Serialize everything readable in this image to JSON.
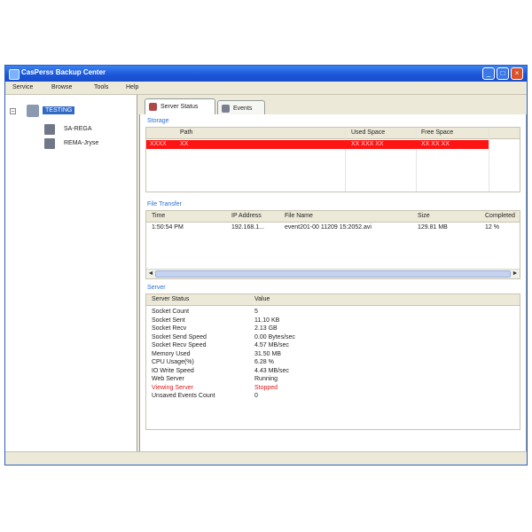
{
  "window": {
    "title": "CasPerss Backup Center",
    "controls": {
      "minimize": "_",
      "maximize": "□",
      "close": "×"
    }
  },
  "menu": [
    "Service",
    "Browse",
    "Tools",
    "Help"
  ],
  "tree": {
    "expander": "−",
    "root": "TESTING",
    "children": [
      "SA-REGA",
      "REMA-Jryse"
    ]
  },
  "tabs": [
    {
      "label": "Server Status",
      "icon": "server-status-icon",
      "active": true
    },
    {
      "label": "Events",
      "icon": "events-icon",
      "active": false
    }
  ],
  "storage": {
    "title": "Storage",
    "columns": [
      "Path",
      "Used Space",
      "Free Space"
    ],
    "rows": [
      {
        "col0": "XXXX",
        "path": "XX",
        "used": "XX XXX XX",
        "free": "XX XX XX",
        "status": "error"
      }
    ]
  },
  "file_transfer": {
    "title": "File Transfer",
    "columns": [
      "Time",
      "IP Address",
      "File Name",
      "Size",
      "Completed"
    ],
    "rows": [
      {
        "time": "1:50:54 PM",
        "ip": "192.168.1...",
        "file": "event201-00 11209 15:2052.avi",
        "size": "129.81 MB",
        "completed": "12 %"
      }
    ],
    "scroll_left": "◄",
    "scroll_right": "►"
  },
  "server": {
    "title": "Server",
    "columns": [
      "Server Status",
      "Value"
    ],
    "rows": [
      {
        "label": "Socket Count",
        "value": "5"
      },
      {
        "label": "Socket Sent",
        "value": "11.10 KB"
      },
      {
        "label": "Socket Recv",
        "value": "2.13 GB"
      },
      {
        "label": "Socket Send Speed",
        "value": "0.00 Bytes/sec"
      },
      {
        "label": "Socket Recv Speed",
        "value": "4.57 MB/sec"
      },
      {
        "label": "Memory Used",
        "value": "31.50 MB"
      },
      {
        "label": "CPU Usage(%)",
        "value": "6.28 %"
      },
      {
        "label": "IO Write Speed",
        "value": "4.43 MB/sec"
      },
      {
        "label": "Web Server",
        "value": "Running"
      },
      {
        "label": "Viewing Server",
        "value": "Stopped",
        "alert": true
      },
      {
        "label": "Unsaved Events Count",
        "value": "0"
      }
    ]
  },
  "colors": {
    "title_bar": "#1a55d8",
    "selection": "#316ac5",
    "error_row": "#ff1414",
    "section_title": "#2a6fd6",
    "alert_text": "#e01818"
  }
}
